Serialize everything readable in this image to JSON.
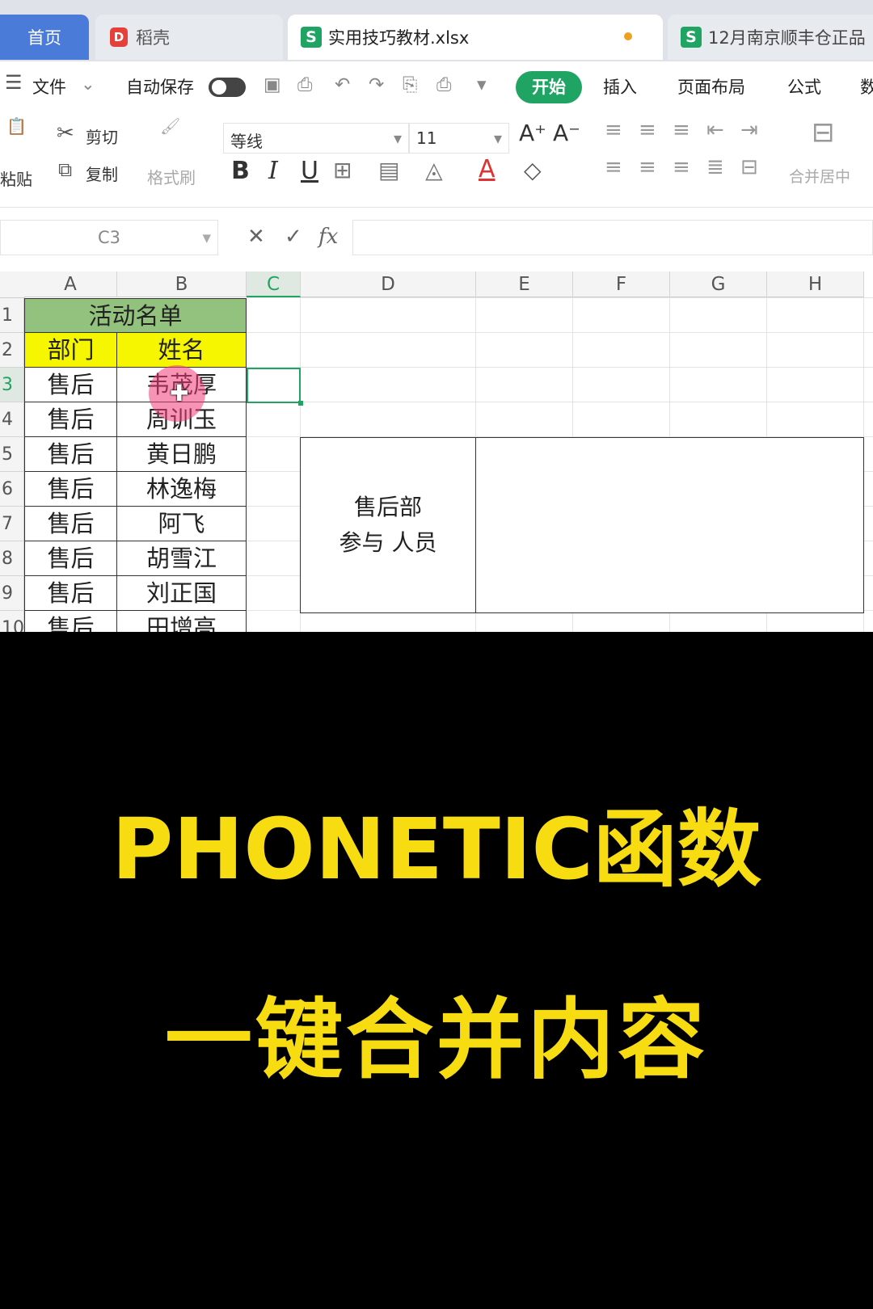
{
  "tabs": {
    "home": "首页",
    "docer": "稻壳",
    "active_file": "实用技巧教材.xlsx",
    "other_file": "12月南京顺丰仓正品"
  },
  "menu": {
    "file": "文件",
    "autosave": "自动保存",
    "start": "开始",
    "insert": "插入",
    "page_layout": "页面布局",
    "formulas": "公式",
    "data_partial": "数"
  },
  "ribbon": {
    "paste": "粘贴",
    "cut": "剪切",
    "copy": "复制",
    "format_painter": "格式刷",
    "font_name": "等线",
    "font_size": "11",
    "merge_center": "合并居中"
  },
  "formula_bar": {
    "name_box": "C3",
    "fx": "fx",
    "formula": ""
  },
  "columns": [
    "A",
    "B",
    "C",
    "D",
    "E",
    "F",
    "G",
    "H"
  ],
  "selected_column": "C",
  "rows": [
    "1",
    "2",
    "3",
    "4",
    "5",
    "6",
    "7",
    "8",
    "9",
    "10"
  ],
  "selected_row": "3",
  "sheet": {
    "title": "活动名单",
    "header_dept": "部门",
    "header_name": "姓名",
    "records": [
      {
        "dept": "售后",
        "name": "韦茂厚"
      },
      {
        "dept": "售后",
        "name": "周训玉"
      },
      {
        "dept": "售后",
        "name": "黄日鹏"
      },
      {
        "dept": "售后",
        "name": "林逸梅"
      },
      {
        "dept": "售后",
        "name": "阿飞"
      },
      {
        "dept": "售后",
        "name": "胡雪江"
      },
      {
        "dept": "售后",
        "name": "刘正国"
      },
      {
        "dept": "售后",
        "name": "田增高"
      }
    ],
    "merged_label_line1": "售后部",
    "merged_label_line2": "参与 人员",
    "merged_value": ""
  },
  "caption": {
    "line1": "PHONETIC函数",
    "line2": "一键合并内容"
  },
  "colors": {
    "accent_green": "#1fa463",
    "title_fill": "#92c27e",
    "header_fill": "#f6f600",
    "caption_yellow": "#f7dc12",
    "tab_blue": "#4b7bd8"
  }
}
